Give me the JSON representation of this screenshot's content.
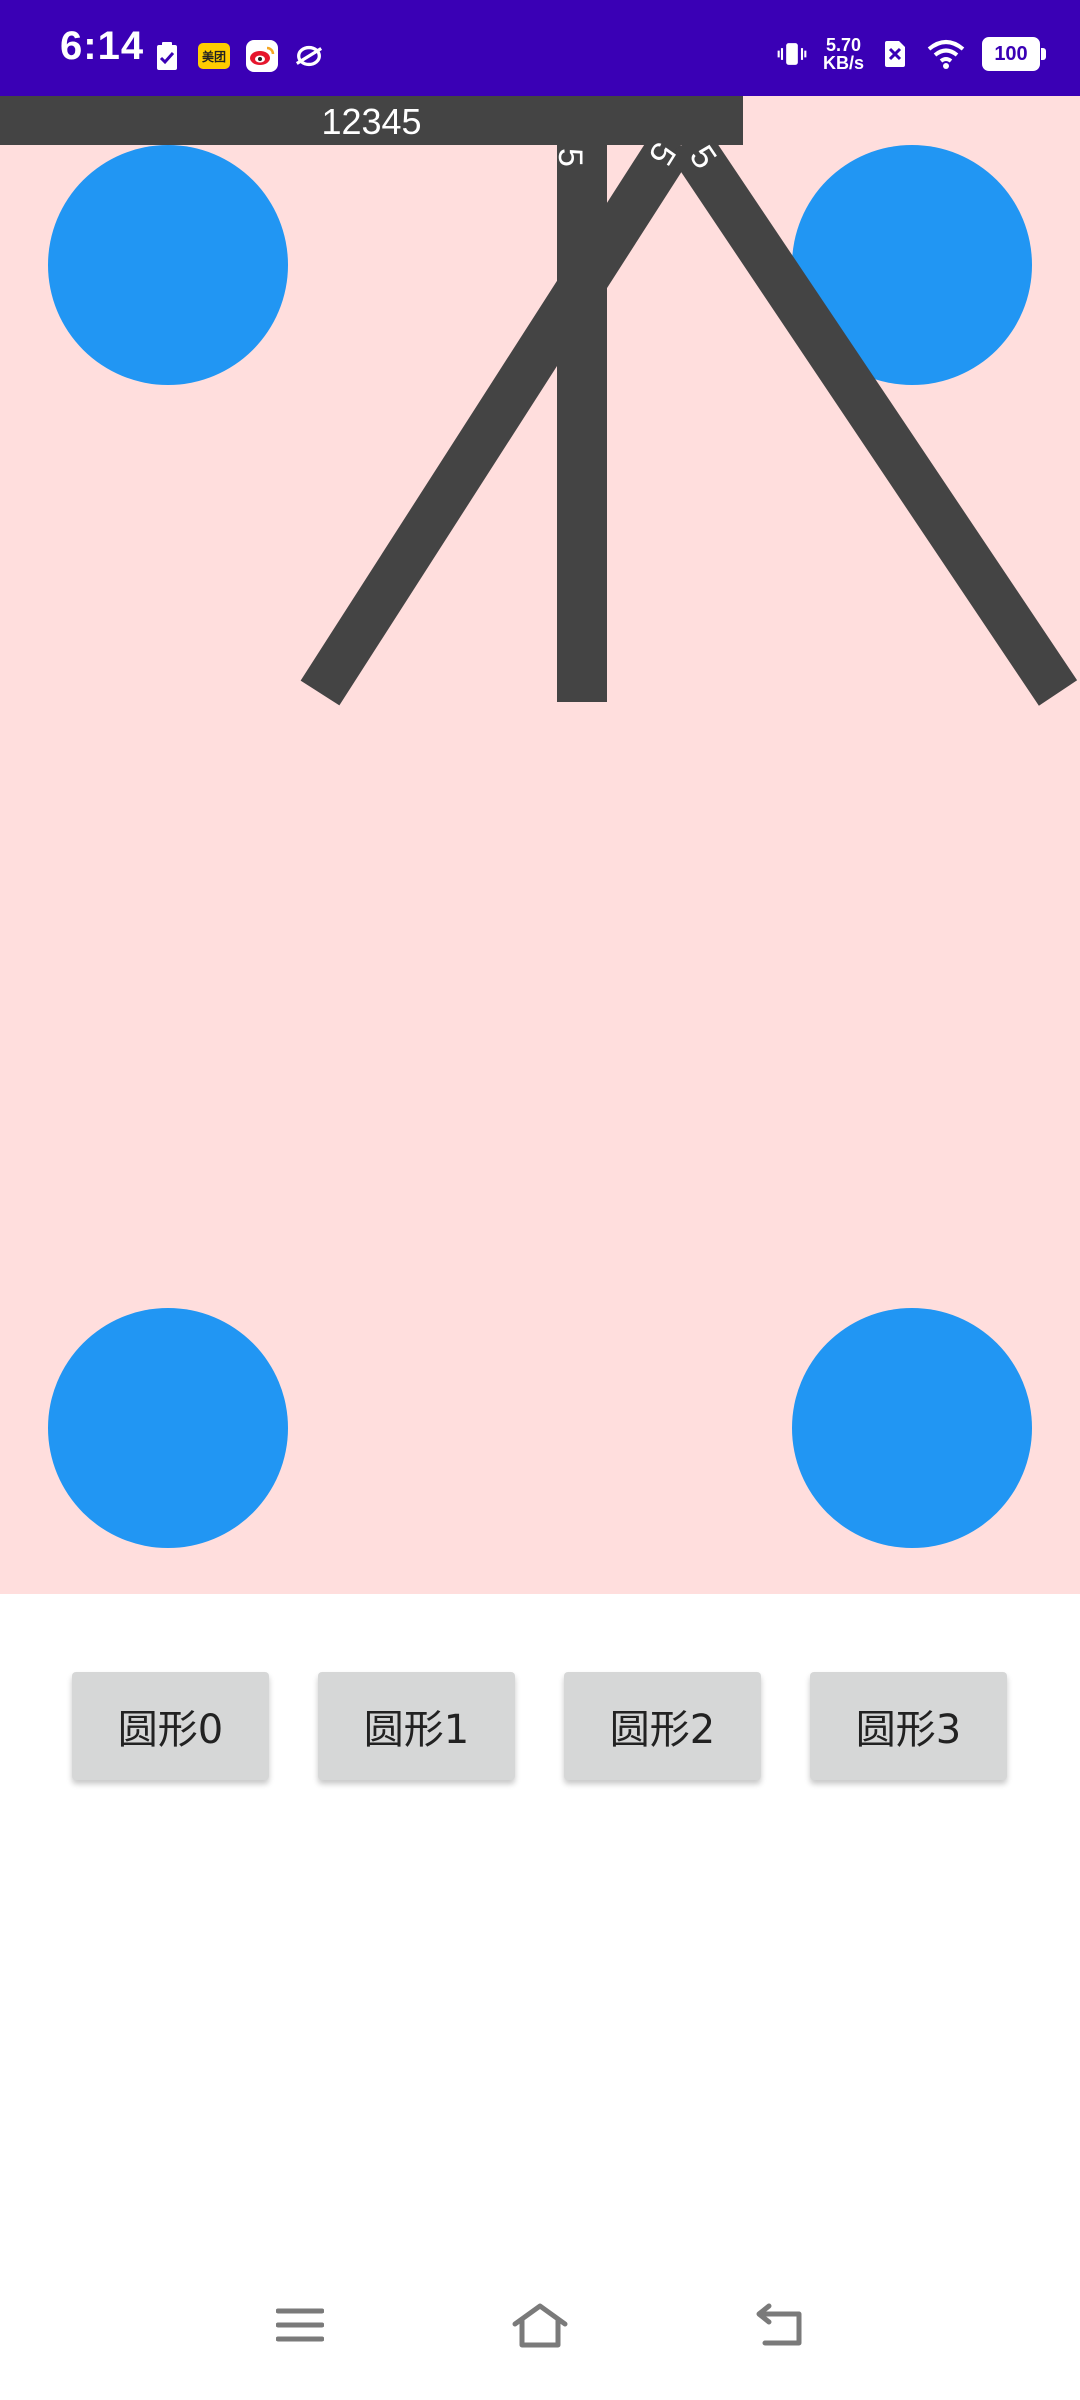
{
  "status_bar": {
    "time": "6:14",
    "net_speed_value": "5.70",
    "net_speed_unit": "KB/s",
    "battery": "100",
    "left_icons": [
      "clipboard-check-icon",
      "meituan-icon",
      "weibo-icon",
      "app-icon"
    ],
    "right_icons": [
      "vibrate-icon",
      "sim-off-icon",
      "wifi-icon",
      "battery-icon"
    ],
    "meituan_label": "美团"
  },
  "canvas": {
    "background_color": "#ffdedd",
    "circle_color": "#2196f3",
    "stick_color": "#444444",
    "top_bar_text": "12345",
    "stick_labels": [
      "5",
      "5",
      "5"
    ]
  },
  "buttons": [
    {
      "label": "圆形0"
    },
    {
      "label": "圆形1"
    },
    {
      "label": "圆形2"
    },
    {
      "label": "圆形3"
    }
  ],
  "nav_bar": {
    "icons": [
      "menu-icon",
      "home-icon",
      "back-icon"
    ]
  }
}
